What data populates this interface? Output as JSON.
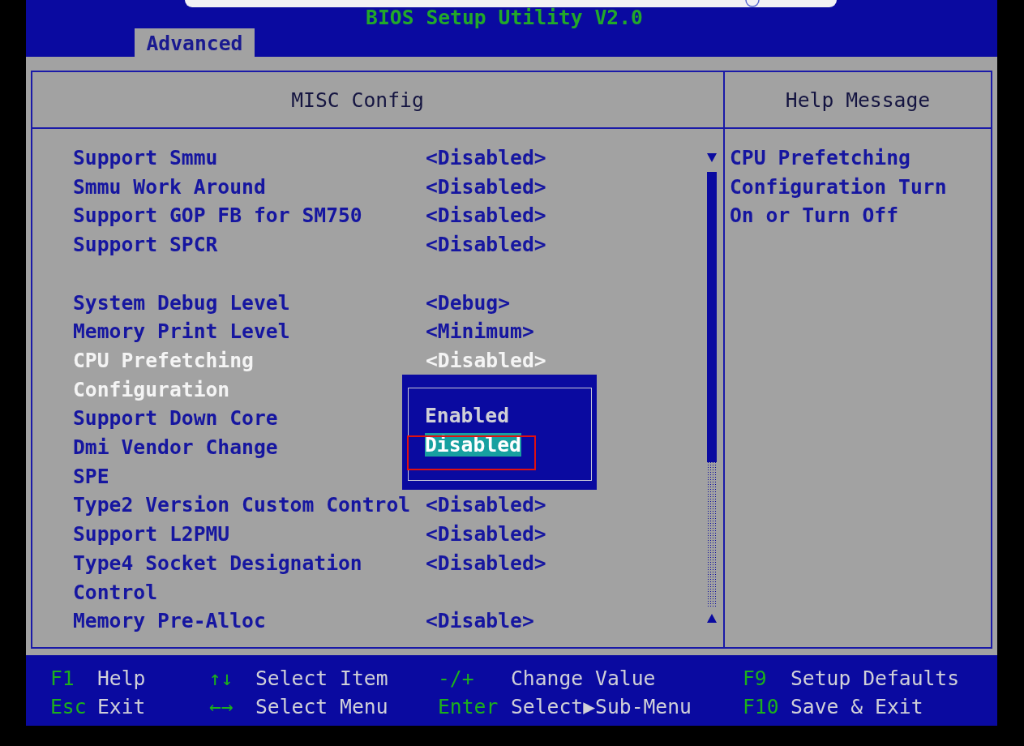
{
  "window": {
    "title": "BIOS Setup Utility V2.0"
  },
  "tabs": [
    {
      "label": "Advanced",
      "selected": true
    }
  ],
  "settings_panel": {
    "title": "MISC Config",
    "groups": [
      {
        "items": [
          {
            "label": "Support Smmu",
            "value": "<Disabled>",
            "selected": false
          },
          {
            "label": "Smmu Work Around",
            "value": "<Disabled>",
            "selected": false
          },
          {
            "label": "Support GOP FB for SM750",
            "value": "<Disabled>",
            "selected": false
          },
          {
            "label": "Support SPCR",
            "value": "<Disabled>",
            "selected": false
          }
        ]
      },
      {
        "items": [
          {
            "label": "System Debug Level",
            "value": "<Debug>",
            "selected": false
          },
          {
            "label": "Memory Print Level",
            "value": "<Minimum>",
            "selected": false
          },
          {
            "label": "CPU Prefetching\nConfiguration",
            "value": "<Disabled>",
            "selected": true
          },
          {
            "label": "Support Down Core",
            "selected": false
          },
          {
            "label": "Dmi Vendor Change",
            "selected": false
          },
          {
            "label": "SPE",
            "selected": false
          },
          {
            "label": "Type2 Version Custom Control",
            "value": "<Disabled>",
            "selected": false
          },
          {
            "label": "Support L2PMU",
            "value": "<Disabled>",
            "selected": false
          },
          {
            "label": "Type4 Socket Designation\nControl",
            "value": "<Disabled>",
            "selected": false
          },
          {
            "label": "Memory Pre-Alloc",
            "value": "<Disable>",
            "selected": false
          }
        ]
      }
    ]
  },
  "option_popup": {
    "options": [
      {
        "label": "Enabled",
        "selected": false
      },
      {
        "label": "Disabled",
        "selected": true
      }
    ]
  },
  "help_panel": {
    "title": "Help Message",
    "text": "CPU Prefetching\nConfiguration Turn\nOn or Turn Off"
  },
  "key_legend": [
    {
      "key": "F1",
      "action": "Help"
    },
    {
      "key": "↑↓",
      "action": "Select Item"
    },
    {
      "key": "-/+",
      "action": "Change Value"
    },
    {
      "key": "F9",
      "action": "Setup Defaults"
    },
    {
      "key": "Esc",
      "action": "Exit"
    },
    {
      "key": "←→",
      "action": "Select Menu"
    },
    {
      "key": "Enter",
      "action": "Select▶Sub-Menu"
    },
    {
      "key": "F10",
      "action": "Save & Exit"
    }
  ]
}
